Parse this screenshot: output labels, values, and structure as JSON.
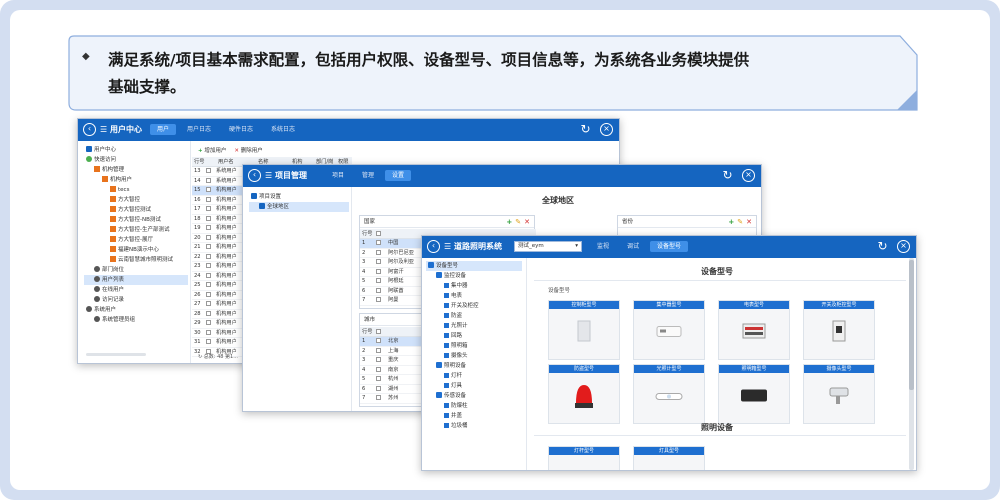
{
  "banner": {
    "bullet": "◆",
    "line1": "满足系统/项目基本需求配置，包括用户权限、设备型号、项目信息等，为系统各业务模块提供",
    "line2": "基础支撑。"
  },
  "win_user": {
    "title": "☰ 用户中心",
    "tabs": [
      "用户",
      "用户日志",
      "硬件日志",
      "系统日志"
    ],
    "active_tab": 0,
    "tree": [
      {
        "label": "用户中心",
        "icon": "home-icon",
        "indent": 0
      },
      {
        "label": "快速访问",
        "icon": "people-icon",
        "indent": 0
      },
      {
        "label": "机构管理",
        "icon": "org-icon",
        "indent": 1
      },
      {
        "label": "机构用户",
        "icon": "org-icon",
        "indent": 2
      },
      {
        "label": "tecs",
        "icon": "org-icon",
        "indent": 3
      },
      {
        "label": "方大智控",
        "icon": "org-icon",
        "indent": 3
      },
      {
        "label": "方大智控测试",
        "icon": "org-icon",
        "indent": 3
      },
      {
        "label": "方大智控-NB测试",
        "icon": "org-icon",
        "indent": 3
      },
      {
        "label": "方大智控-生产部测试",
        "icon": "org-icon",
        "indent": 3
      },
      {
        "label": "方大智控-展厅",
        "icon": "org-icon",
        "indent": 3
      },
      {
        "label": "福建NB演示中心",
        "icon": "org-icon",
        "indent": 3
      },
      {
        "label": "云南智慧城市照明测试",
        "icon": "org-icon",
        "indent": 3
      },
      {
        "label": "部门岗位",
        "icon": "user-icon",
        "indent": 1
      },
      {
        "label": "用户列表",
        "icon": "user-icon",
        "indent": 1,
        "selected": true
      },
      {
        "label": "在线用户",
        "icon": "user-icon",
        "indent": 1
      },
      {
        "label": "访问记录",
        "icon": "user-icon",
        "indent": 1
      },
      {
        "label": "系统用户",
        "icon": "user-icon",
        "indent": 0
      },
      {
        "label": "系统管理员组",
        "icon": "user-icon",
        "indent": 1
      }
    ],
    "toolbar": {
      "add": "增加用户",
      "del": "删除用户"
    },
    "grid_head": [
      "行号",
      "",
      "用户名",
      "名称",
      "机构",
      "部门/岗位",
      "权限"
    ],
    "rows": [
      {
        "no": "13",
        "name": "系统用户"
      },
      {
        "no": "14",
        "name": "系统用户"
      },
      {
        "no": "15",
        "name": "机构用户",
        "selected": true
      },
      {
        "no": "16",
        "name": "机构用户"
      },
      {
        "no": "17",
        "name": "机构用户"
      },
      {
        "no": "18",
        "name": "机构用户"
      },
      {
        "no": "19",
        "name": "机构用户"
      },
      {
        "no": "20",
        "name": "机构用户"
      },
      {
        "no": "21",
        "name": "机构用户"
      },
      {
        "no": "22",
        "name": "机构用户"
      },
      {
        "no": "23",
        "name": "机构用户"
      },
      {
        "no": "24",
        "name": "机构用户"
      },
      {
        "no": "25",
        "name": "机构用户"
      },
      {
        "no": "26",
        "name": "机构用户"
      },
      {
        "no": "27",
        "name": "机构用户"
      },
      {
        "no": "28",
        "name": "机构用户"
      },
      {
        "no": "29",
        "name": "机构用户"
      },
      {
        "no": "30",
        "name": "机构用户"
      },
      {
        "no": "31",
        "name": "机构用户"
      },
      {
        "no": "32",
        "name": "机构用户"
      }
    ],
    "status": "总数: 48   第1..."
  },
  "win_project": {
    "title": "☰ 项目管理",
    "tabs": [
      "项目",
      "管理",
      "设置"
    ],
    "active_tab": 2,
    "tree": [
      {
        "label": "项目设置",
        "icon": "home-icon",
        "indent": 0
      },
      {
        "label": "全球地区",
        "icon": "globe-icon",
        "indent": 1,
        "selected": true
      }
    ],
    "main_title": "全球地区",
    "panel_country": "国家",
    "panel_province": "省份",
    "panel_city": "城市",
    "country_rows": [
      {
        "no": "1",
        "name": "中国",
        "selected": true
      },
      {
        "no": "2",
        "name": "阿尔巴尼亚"
      },
      {
        "no": "3",
        "name": "阿尔及利亚"
      },
      {
        "no": "4",
        "name": "阿富汗"
      },
      {
        "no": "5",
        "name": "阿根廷"
      },
      {
        "no": "6",
        "name": "阿联酋"
      },
      {
        "no": "7",
        "name": "阿曼"
      }
    ],
    "city_rows": [
      {
        "no": "1",
        "name": "北京",
        "selected": true
      },
      {
        "no": "2",
        "name": "上海"
      },
      {
        "no": "3",
        "name": "重庆"
      },
      {
        "no": "4",
        "name": "南京"
      },
      {
        "no": "5",
        "name": "杭州"
      },
      {
        "no": "6",
        "name": "湖州"
      },
      {
        "no": "7",
        "name": "苏州"
      }
    ],
    "col_no": "行号"
  },
  "win_light": {
    "title": "☰ 道路照明系统",
    "project_select": "测试_eym",
    "tabs": [
      "监视",
      "调试",
      "设备型号"
    ],
    "active_tab": 2,
    "tree": [
      {
        "label": "设备型号",
        "icon": "folder-icon",
        "indent": 0,
        "selected": true
      },
      {
        "label": "监控设备",
        "icon": "folder-icon",
        "indent": 1
      },
      {
        "label": "集中器",
        "icon": "device-icon",
        "indent": 2
      },
      {
        "label": "电表",
        "icon": "device-icon",
        "indent": 2
      },
      {
        "label": "开关及柜控",
        "icon": "device-icon",
        "indent": 2
      },
      {
        "label": "防盗",
        "icon": "device-icon",
        "indent": 2
      },
      {
        "label": "光照计",
        "icon": "device-icon",
        "indent": 2
      },
      {
        "label": "回路",
        "icon": "device-icon",
        "indent": 2
      },
      {
        "label": "照明箱",
        "icon": "device-icon",
        "indent": 2
      },
      {
        "label": "摄像头",
        "icon": "device-icon",
        "indent": 2
      },
      {
        "label": "照明设备",
        "icon": "folder-icon",
        "indent": 1
      },
      {
        "label": "灯杆",
        "icon": "device-icon",
        "indent": 2
      },
      {
        "label": "灯具",
        "icon": "device-icon",
        "indent": 2
      },
      {
        "label": "传感设备",
        "icon": "folder-icon",
        "indent": 1
      },
      {
        "label": "防爆柱",
        "icon": "device-icon",
        "indent": 2
      },
      {
        "label": "井盖",
        "icon": "device-icon",
        "indent": 2
      },
      {
        "label": "垃圾桶",
        "icon": "device-icon",
        "indent": 2
      }
    ],
    "main_title": "设备型号",
    "group_label": "设备型号",
    "cards_row1": [
      "控制柜型号",
      "集中器型号",
      "电表型号",
      "开关及柜控型号"
    ],
    "cards_row2": [
      "防盗型号",
      "光照计型号",
      "照明箱型号",
      "摄像头型号"
    ],
    "lighting_title": "照明设备",
    "cards_row3": [
      "灯杆型号",
      "灯具型号"
    ]
  },
  "colors": {
    "titlebar": "#1565c0",
    "accent": "#3f8fe8",
    "selection": "#d6e6fb"
  }
}
